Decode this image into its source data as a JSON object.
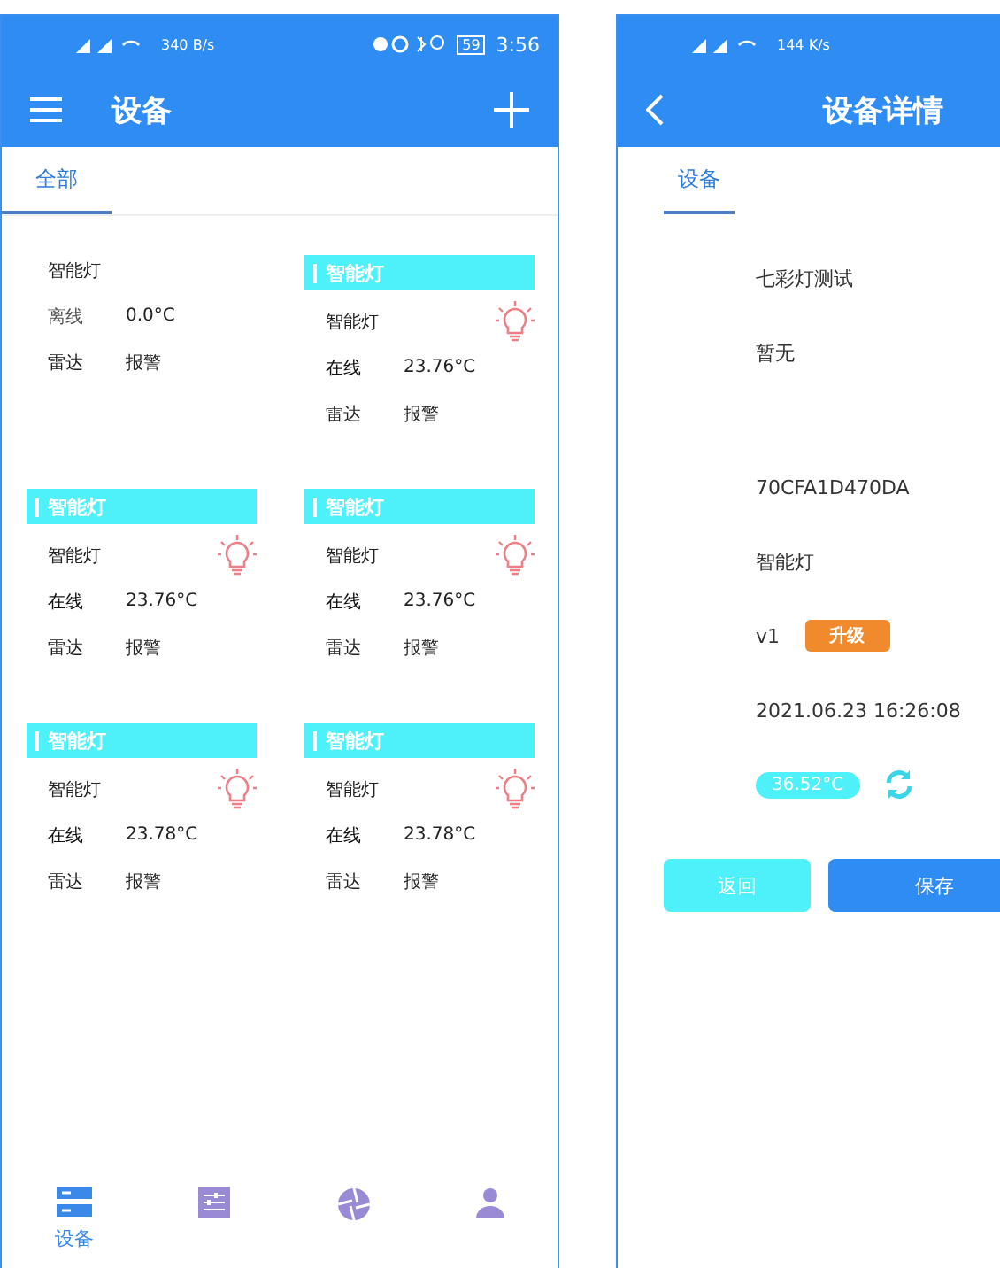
{
  "left_screen": {
    "status_bar": {
      "speed": "340 B/s",
      "battery": "59",
      "time": "3:56"
    },
    "header": {
      "title": "设备"
    },
    "tabs": [
      {
        "label": "全部",
        "selected": true
      }
    ],
    "devices": [
      {
        "name": "智能灯",
        "online": false,
        "status": "离线",
        "temperature": "0.0°C",
        "sensor": "雷达",
        "alarm": "报警"
      },
      {
        "header": "智能灯",
        "name": "智能灯",
        "online": true,
        "status": "在线",
        "temperature": "23.76°C",
        "sensor": "雷达",
        "alarm": "报警"
      },
      {
        "header": "智能灯",
        "name": "智能灯",
        "online": true,
        "status": "在线",
        "temperature": "23.76°C",
        "sensor": "雷达",
        "alarm": "报警"
      },
      {
        "header": "智能灯",
        "name": "智能灯",
        "online": true,
        "status": "在线",
        "temperature": "23.76°C",
        "sensor": "雷达",
        "alarm": "报警"
      },
      {
        "header": "智能灯",
        "name": "智能灯",
        "online": true,
        "status": "在线",
        "temperature": "23.78°C",
        "sensor": "雷达",
        "alarm": "报警"
      },
      {
        "header": "智能灯",
        "name": "智能灯",
        "online": true,
        "status": "在线",
        "temperature": "23.78°C",
        "sensor": "雷达",
        "alarm": "报警"
      }
    ],
    "bottom_nav": [
      {
        "label": "设备",
        "kind": "list",
        "selected": true
      },
      {
        "kind": "sliders",
        "selected": false
      },
      {
        "kind": "aperture",
        "selected": false
      },
      {
        "kind": "person",
        "selected": false
      }
    ]
  },
  "right_screen": {
    "status_bar": {
      "speed": "144 K/s"
    },
    "header": {
      "title": "设备详情"
    },
    "tabs": [
      {
        "label": "设备",
        "selected": true
      }
    ],
    "fields": [
      {
        "kind": "text",
        "value": "七彩灯测试"
      },
      {
        "kind": "text",
        "value": "暂无"
      },
      {
        "kind": "gap"
      },
      {
        "kind": "text",
        "value": "70CFA1D470DA"
      },
      {
        "kind": "text",
        "value": "智能灯"
      },
      {
        "kind": "version",
        "value": "v1",
        "action": "升级"
      },
      {
        "kind": "text",
        "value": "2021.06.23 16:26:08"
      },
      {
        "kind": "temperature",
        "value": "36.52°C"
      }
    ],
    "buttons": [
      {
        "label": "返回",
        "kind": "secondary"
      },
      {
        "label": "保存",
        "kind": "primary"
      }
    ]
  }
}
